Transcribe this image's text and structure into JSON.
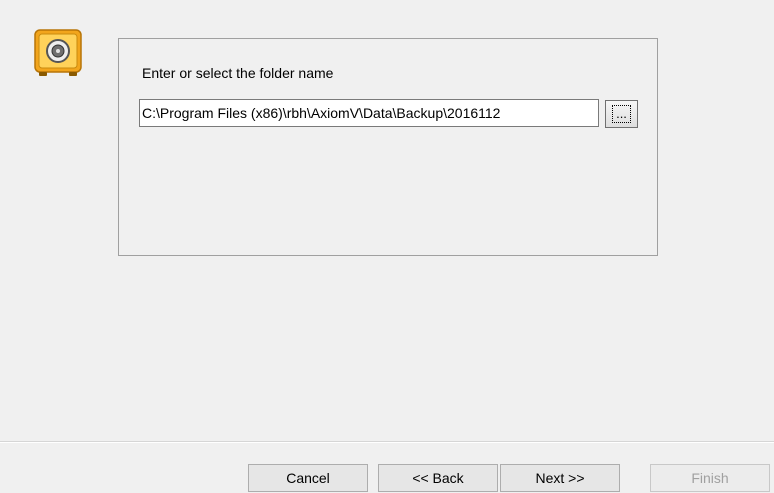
{
  "panel": {
    "label": "Enter or select the folder name",
    "folder_path": "C:\\Program Files (x86)\\rbh\\AxiomV\\Data\\Backup\\2016112",
    "browse_label": "..."
  },
  "buttons": {
    "cancel": "Cancel",
    "back": "<< Back",
    "next": "Next >>",
    "finish": "Finish"
  },
  "icon": {
    "name": "safe-icon",
    "color": "#f2a51c"
  }
}
